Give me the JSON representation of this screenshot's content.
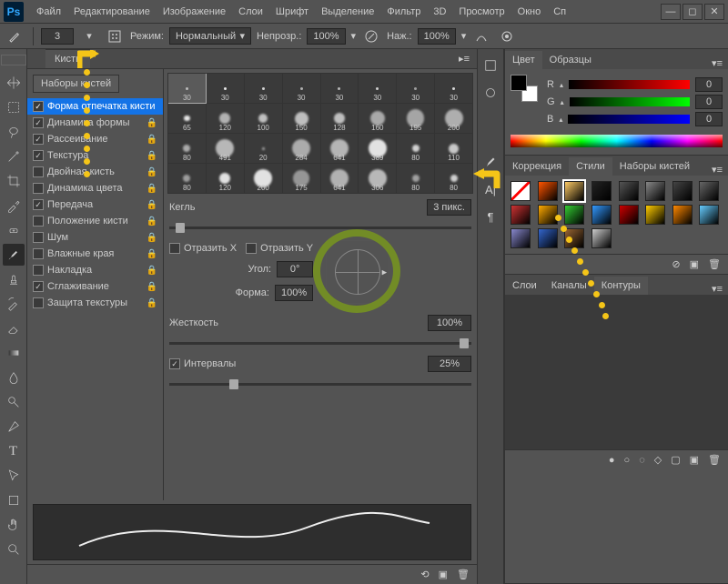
{
  "menubar": {
    "items": [
      "Файл",
      "Редактирование",
      "Изображение",
      "Слои",
      "Шрифт",
      "Выделение",
      "Фильтр",
      "3D",
      "Просмотр",
      "Окно",
      "Сп"
    ]
  },
  "options": {
    "brush_size": "3",
    "mode_label": "Режим:",
    "mode_value": "Нормальный",
    "opacity_label": "Непрозр.:",
    "opacity_value": "100%",
    "flow_label": "Наж.:",
    "flow_value": "100%"
  },
  "brush_panel": {
    "tab_label": "Кисть",
    "presets_button": "Наборы кистей",
    "items": [
      {
        "label": "Форма отпечатка кисти",
        "checked": true,
        "selected": true,
        "lock": false
      },
      {
        "label": "Динамика формы",
        "checked": true,
        "lock": true
      },
      {
        "label": "Рассеивание",
        "checked": true,
        "lock": true
      },
      {
        "label": "Текстура",
        "checked": true,
        "lock": true
      },
      {
        "label": "Двойная кисть",
        "checked": false,
        "lock": true
      },
      {
        "label": "Динамика цвета",
        "checked": false,
        "lock": true
      },
      {
        "label": "Передача",
        "checked": true,
        "lock": true
      },
      {
        "label": "Положение кисти",
        "checked": false,
        "lock": true
      },
      {
        "label": "Шум",
        "checked": false,
        "lock": true
      },
      {
        "label": "Влажные края",
        "checked": false,
        "lock": true
      },
      {
        "label": "Накладка",
        "checked": false,
        "lock": true
      },
      {
        "label": "Сглаживание",
        "checked": true,
        "lock": true
      },
      {
        "label": "Защита текстуры",
        "checked": false,
        "lock": true
      }
    ],
    "grid_sizes": [
      30,
      30,
      30,
      30,
      30,
      30,
      30,
      30,
      65,
      120,
      100,
      150,
      128,
      160,
      195,
      200,
      80,
      491,
      20,
      284,
      641,
      389,
      80,
      110,
      80,
      120,
      200,
      175,
      641,
      306,
      80,
      80
    ],
    "size_label": "Кегль",
    "size_value": "3 пикс.",
    "flip_x": "Отразить X",
    "flip_y": "Отразить Y",
    "angle_label": "Угол:",
    "angle_value": "0°",
    "roundness_label": "Форма:",
    "roundness_value": "100%",
    "hardness_label": "Жесткость",
    "hardness_value": "100%",
    "spacing_label": "Интервалы",
    "spacing_value": "25%"
  },
  "color_panel": {
    "tabs": [
      "Цвет",
      "Образцы"
    ],
    "channels": {
      "R": "R",
      "G": "G",
      "B": "B"
    },
    "values": {
      "R": "0",
      "G": "0",
      "B": "0"
    }
  },
  "styles_panel": {
    "tabs": [
      "Коррекция",
      "Стили",
      "Наборы кистей"
    ],
    "swatches": [
      "#ffffff",
      "#ff5500",
      "#ffcc66",
      "#222222",
      "#555555",
      "#888888",
      "#444444",
      "#666666",
      "#cc3333",
      "#ffaa00",
      "#33cc33",
      "#3399ff",
      "#cc0000",
      "#ffcc00",
      "#ff8800",
      "#66ccff",
      "#8888cc",
      "#3366cc",
      "#996633",
      "#cccccc"
    ]
  },
  "layers_panel": {
    "tabs": [
      "Слои",
      "Каналы",
      "Контуры"
    ]
  }
}
